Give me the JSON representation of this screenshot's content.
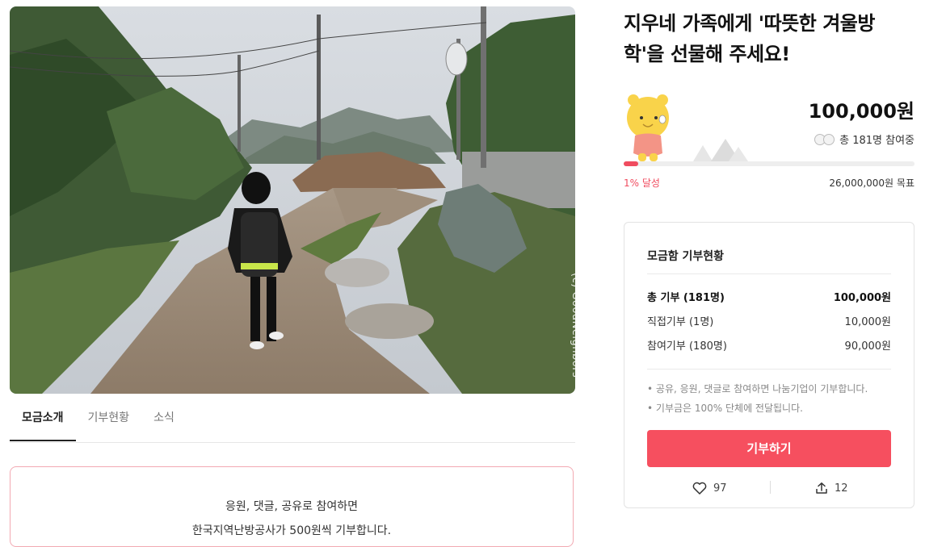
{
  "campaign": {
    "title": "지우네 가족에게 '따뜻한 겨울방학'을 선물해 주세요!",
    "amount": "100,000원",
    "participants": "총 181명 참여중",
    "progress_fraction": 0.01,
    "achieve_label": "1% 달성",
    "goal_label": "26,000,000원 목표",
    "photo_credit": "(c) GoodNeighbors"
  },
  "tabs": [
    {
      "label": "모금소개",
      "active": true
    },
    {
      "label": "기부현황",
      "active": false
    },
    {
      "label": "소식",
      "active": false
    }
  ],
  "notice": {
    "line1": "응원, 댓글, 공유로 참여하면",
    "line2": "한국지역난방공사가 500원씩 기부합니다."
  },
  "summary": {
    "title": "모금함 기부현황",
    "rows": [
      {
        "label": "총 기부 (181명)",
        "value": "100,000원"
      },
      {
        "label": "직접기부 (1명)",
        "value": "10,000원"
      },
      {
        "label": "참여기부 (180명)",
        "value": "90,000원"
      }
    ],
    "bullets": [
      "공유, 응원, 댓글로 참여하면 나눔기업이 기부합니다.",
      "기부금은 100% 단체에 전달됩니다."
    ],
    "donate_label": "기부하기",
    "like_count": "97",
    "share_count": "12"
  },
  "icons": {
    "like": "heart-icon",
    "share": "share-icon"
  },
  "colors": {
    "accent": "#f64f5f",
    "progress": "#f04c5f"
  }
}
